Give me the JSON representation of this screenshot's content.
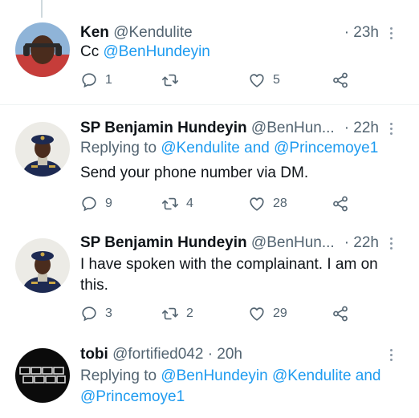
{
  "tweets": [
    {
      "name": "Ken",
      "handle": "@Kendulite",
      "time": "· 23h",
      "text_prefix": "Cc ",
      "mention": "@BenHundeyin",
      "replies": "1",
      "retweets": "",
      "likes": "5"
    },
    {
      "name": "SP Benjamin Hundeyin",
      "handle": "@BenHun...",
      "time": "· 22h",
      "replying_prefix": "Replying to ",
      "replying_targets": "@Kendulite and @Princemoye1",
      "text": "Send your phone number via DM.",
      "replies": "9",
      "retweets": "4",
      "likes": "28"
    },
    {
      "name": "SP Benjamin Hundeyin",
      "handle": "@BenHun...",
      "time": "· 22h",
      "text_line1": "I have spoken with the complainant. I am on",
      "text_line2": "this.",
      "replies": "3",
      "retweets": "2",
      "likes": "29"
    },
    {
      "name": "tobi",
      "handle": "@fortified042",
      "time": "· 20h",
      "replying_prefix": "Replying to ",
      "replying_line1": "@BenHundeyin @Kendulite and",
      "replying_line2": "@Princemoye1"
    }
  ],
  "icons": {
    "reply": "reply-icon",
    "retweet": "retweet-icon",
    "like": "heart-icon",
    "share": "share-icon",
    "more": "more-icon"
  },
  "colors": {
    "link": "#1d9bf0",
    "secondary_text": "#536471",
    "primary_text": "#0f1419",
    "divider": "#eff3f4"
  }
}
